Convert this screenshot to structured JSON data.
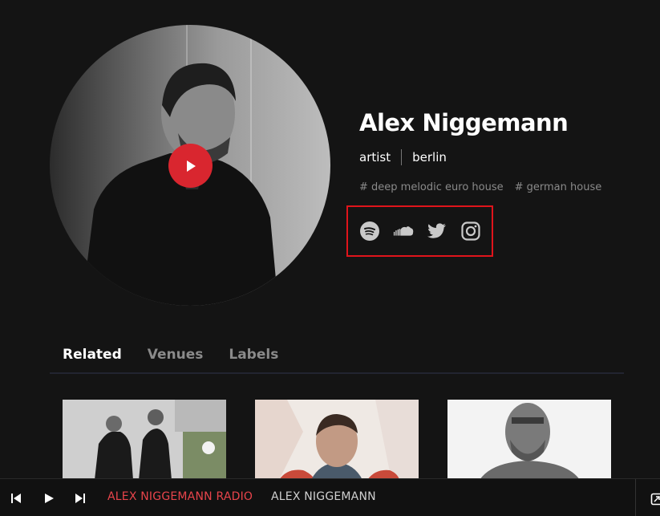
{
  "artist": {
    "name": "Alex Niggemann",
    "role": "artist",
    "city": "berlin",
    "tags": [
      "# deep melodic euro house",
      "# german house"
    ],
    "social": [
      "spotify-icon",
      "soundcloud-icon",
      "twitter-icon",
      "instagram-icon"
    ]
  },
  "tabs": [
    {
      "label": "Related",
      "active": true
    },
    {
      "label": "Venues",
      "active": false
    },
    {
      "label": "Labels",
      "active": false
    }
  ],
  "player": {
    "title": "ALEX NIGGEMANN RADIO",
    "artist": "ALEX NIGGEMANN"
  },
  "colors": {
    "accent": "#d9262f",
    "highlight_box": "#e0141b",
    "background": "#141414",
    "player_title": "#e8444b"
  }
}
